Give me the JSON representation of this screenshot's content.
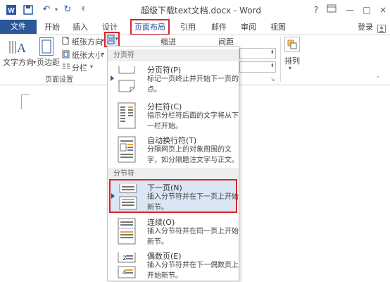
{
  "window": {
    "title": "超级下载text文档.docx - Word",
    "help": "?",
    "minimize": "—",
    "restore": "□",
    "close": "×"
  },
  "tabs": {
    "file": "文件",
    "home": "开始",
    "insert": "插入",
    "design": "设计",
    "layout": "页面布局",
    "references": "引用",
    "mailings": "邮件",
    "review": "审阅",
    "view": "视图",
    "login": "登录"
  },
  "ribbon": {
    "text_direction": "文字方向",
    "margins": "页边距",
    "orientation": "纸张方向",
    "size": "纸张大小",
    "columns": "分栏",
    "group_page_setup": "页面设置",
    "indent": "缩进",
    "spacing": "间距",
    "arrange": "排列"
  },
  "menu": {
    "section_page_breaks": "分页符",
    "section_section_breaks": "分节符",
    "items": [
      {
        "title": "分页符(P)",
        "desc": "标记一页终止并开始下一页的点。"
      },
      {
        "title": "分栏符(C)",
        "desc": "指示分栏符后面的文字将从下一栏开始。"
      },
      {
        "title": "自动换行符(T)",
        "desc": "分隔网页上的对象周围的文字，如分隔题注文字与正文。"
      },
      {
        "title": "下一页(N)",
        "desc": "插入分节符并在下一页上开始新节。"
      },
      {
        "title": "连续(O)",
        "desc": "插入分节符并在同一页上开始新节。"
      },
      {
        "title": "偶数页(E)",
        "desc": "插入分节符并在下一偶数页上开始新节。"
      }
    ]
  }
}
